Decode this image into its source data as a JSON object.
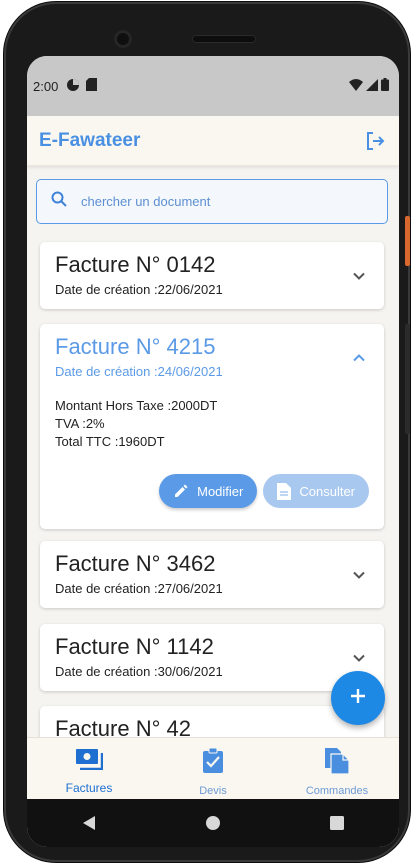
{
  "status_bar": {
    "time": "2:00"
  },
  "app": {
    "title": "E-Fawateer"
  },
  "search": {
    "placeholder": "chercher un document",
    "value": ""
  },
  "colors": {
    "accent": "#5b9ae6",
    "fab": "#1e88e5",
    "status_bar_bg": "#c8c8c8"
  },
  "invoices": [
    {
      "title": "Facture N° 0142",
      "date": "Date de création :22/06/2021",
      "expanded": false
    },
    {
      "title": "Facture N° 4215",
      "date": "Date de création :24/06/2021",
      "expanded": true,
      "details": {
        "montant": "Montant Hors Taxe :2000DT",
        "tva": "TVA :2%",
        "total": "Total TTC :1960DT"
      },
      "actions": {
        "modifier": "Modifier",
        "consulter": "Consulter"
      }
    },
    {
      "title": "Facture N° 3462",
      "date": "Date de création :27/06/2021",
      "expanded": false
    },
    {
      "title": "Facture N° 1142",
      "date": "Date de création :30/06/2021",
      "expanded": false
    },
    {
      "title": "Facture N° 42",
      "date": "",
      "expanded": false
    }
  ],
  "bottom_nav": [
    {
      "label": "Factures",
      "icon": "receipt-icon",
      "active": true
    },
    {
      "label": "Devis",
      "icon": "clipboard-check-icon",
      "active": false
    },
    {
      "label": "Commandes",
      "icon": "file-copy-icon",
      "active": false
    }
  ]
}
